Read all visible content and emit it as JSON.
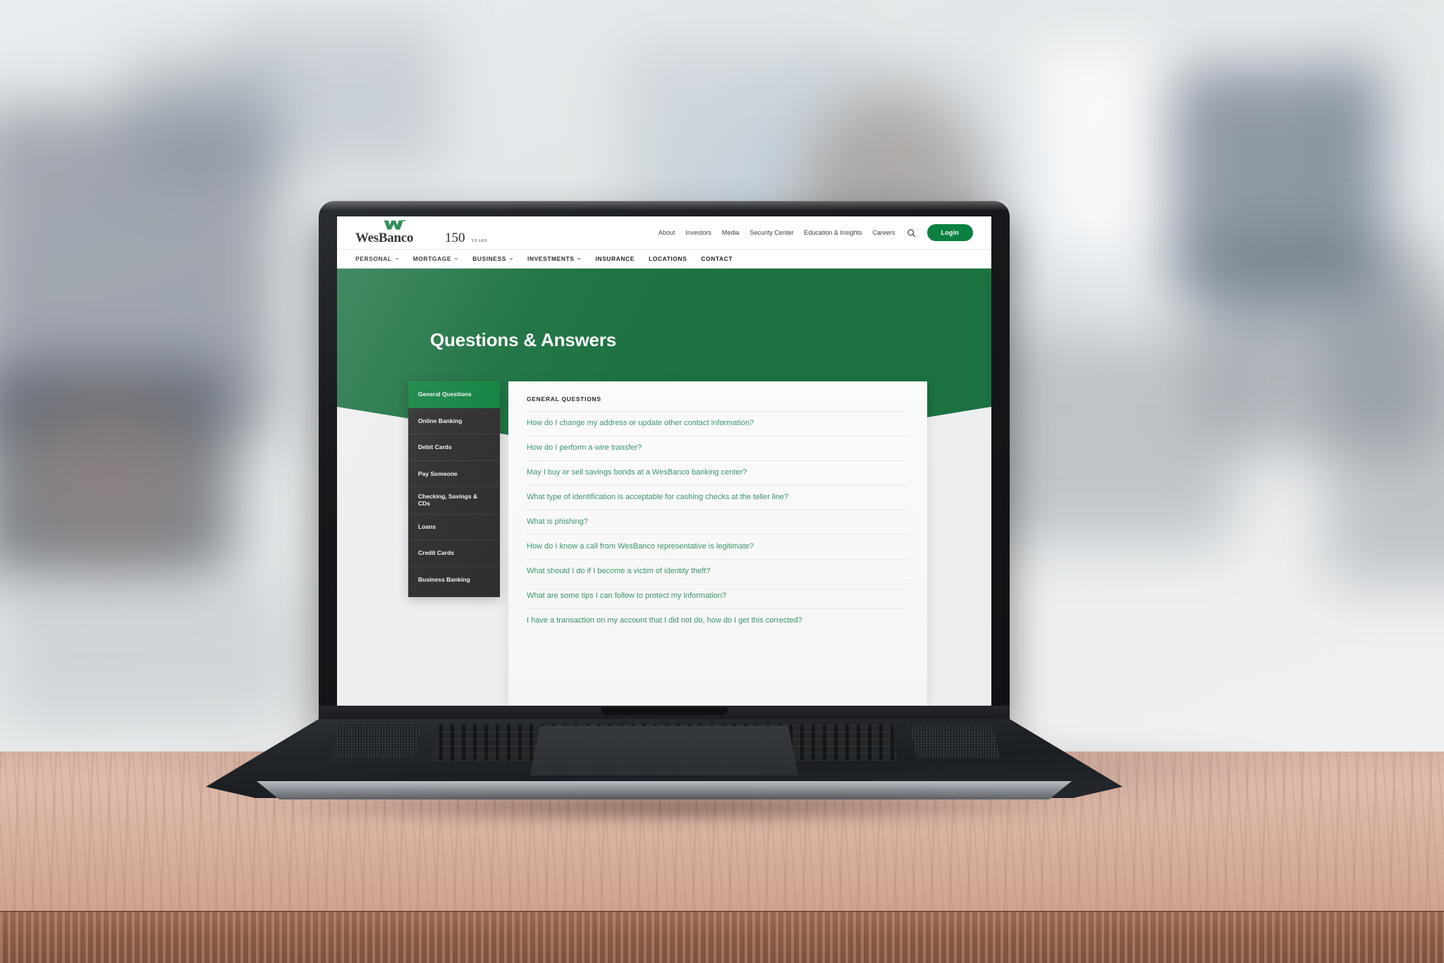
{
  "site": {
    "brand": {
      "name": "WesBanco",
      "anniversary": "150",
      "anniversary_unit": "YEARS",
      "mark": "wesbanco-w-chevron",
      "brand_green": "#1b7140",
      "accent_green": "#0c8040"
    },
    "utility_nav": {
      "links": [
        {
          "label": "About"
        },
        {
          "label": "Investors"
        },
        {
          "label": "Media"
        },
        {
          "label": "Security Center"
        },
        {
          "label": "Education & Insights"
        },
        {
          "label": "Careers"
        }
      ],
      "search_icon": "search-icon",
      "login_label": "Login"
    },
    "main_nav": {
      "items": [
        {
          "label": "PERSONAL",
          "has_dropdown": true
        },
        {
          "label": "MORTGAGE",
          "has_dropdown": true
        },
        {
          "label": "BUSINESS",
          "has_dropdown": true
        },
        {
          "label": "INVESTMENTS",
          "has_dropdown": true
        },
        {
          "label": "INSURANCE",
          "has_dropdown": false
        },
        {
          "label": "LOCATIONS",
          "has_dropdown": false
        },
        {
          "label": "CONTACT",
          "has_dropdown": false
        }
      ]
    },
    "hero": {
      "title": "Questions & Answers"
    },
    "sidebar": {
      "items": [
        {
          "label": "General Questions",
          "active": true
        },
        {
          "label": "Online Banking",
          "active": false
        },
        {
          "label": "Debit Cards",
          "active": false
        },
        {
          "label": "Pay Someone",
          "active": false
        },
        {
          "label": "Checking, Savings & CDs",
          "active": false
        },
        {
          "label": "Loans",
          "active": false
        },
        {
          "label": "Credit Cards",
          "active": false
        },
        {
          "label": "Business Banking",
          "active": false
        }
      ]
    },
    "content": {
      "heading": "GENERAL QUESTIONS",
      "questions": [
        {
          "text": "How do I change my address or update other contact information?"
        },
        {
          "text": "How do I perform a wire transfer?"
        },
        {
          "text": "May I buy or sell savings bonds at a WesBanco banking center?"
        },
        {
          "text": "What type of identification is acceptable for cashing checks at the teller line?"
        },
        {
          "text": "What is phishing?"
        },
        {
          "text": "How do I know a call from WesBanco representative is legitimate?"
        },
        {
          "text": "What should I do if I become a victim of identity theft?"
        },
        {
          "text": "What are some tips I can follow to protect my information?"
        },
        {
          "text": "I have a transaction on my account that I did not do, how do I get this corrected?"
        }
      ]
    }
  }
}
